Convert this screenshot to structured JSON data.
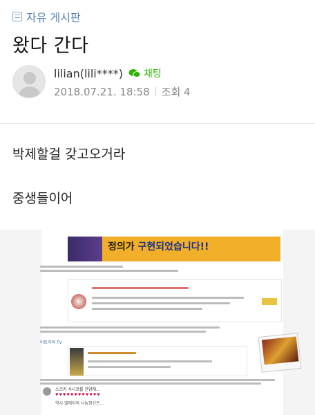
{
  "board": {
    "name": "자유 게시판",
    "icon": "board-list-icon"
  },
  "post": {
    "title": "왔다 간다",
    "author": "lilian(lili****)",
    "chat_label": "채팅",
    "date": "2018.07.21. 18:58",
    "views": "조회 4",
    "lines": [
      "박제할걸 갖고오거라",
      "중생들이어"
    ]
  },
  "embed": {
    "banner_headline_1": "정의가 ",
    "banner_headline_2": "구현되었습니다!!",
    "tv_label": "이토리의 TV",
    "comment_author": "스즈키 사나코를 찬양해...",
    "comment_hearts": "♥♥♥♥♥♥♥♥♥♥♥♥",
    "comment_text": "역시 엘레이의 나눔정신은..."
  },
  "colors": {
    "link": "#5b84b1",
    "chat": "#2db400",
    "banner": "#f2b02a"
  }
}
